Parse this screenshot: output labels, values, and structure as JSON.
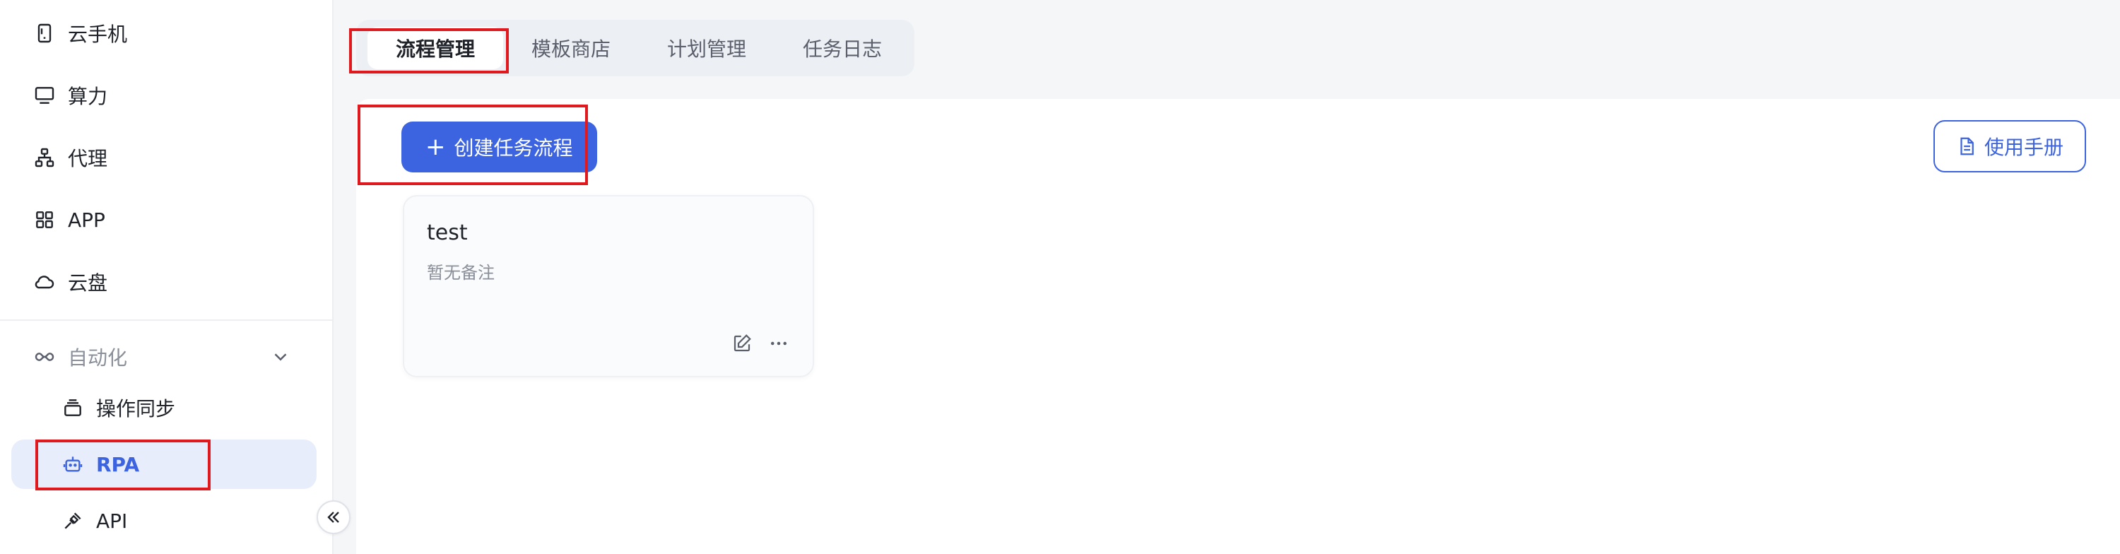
{
  "sidebar": {
    "items": [
      {
        "label": "云手机",
        "icon": "phone-icon"
      },
      {
        "label": "算力",
        "icon": "monitor-icon"
      },
      {
        "label": "代理",
        "icon": "network-icon"
      },
      {
        "label": "APP",
        "icon": "grid-icon"
      },
      {
        "label": "云盘",
        "icon": "cloud-icon"
      }
    ],
    "group": {
      "label": "自动化",
      "icon": "infinity-icon"
    },
    "sub_items": [
      {
        "label": "操作同步",
        "icon": "layers-icon"
      },
      {
        "label": "RPA",
        "icon": "robot-icon"
      },
      {
        "label": "API",
        "icon": "plug-icon"
      }
    ]
  },
  "tabs": [
    {
      "label": "流程管理",
      "active": true
    },
    {
      "label": "模板商店",
      "active": false
    },
    {
      "label": "计划管理",
      "active": false
    },
    {
      "label": "任务日志",
      "active": false
    }
  ],
  "toolbar": {
    "create_label": "创建任务流程",
    "manual_label": "使用手册"
  },
  "card": {
    "title": "test",
    "note": "暂无备注"
  },
  "colors": {
    "accent": "#3c63e0",
    "active_bg": "#e8edfb",
    "highlight": "#e0191f"
  }
}
